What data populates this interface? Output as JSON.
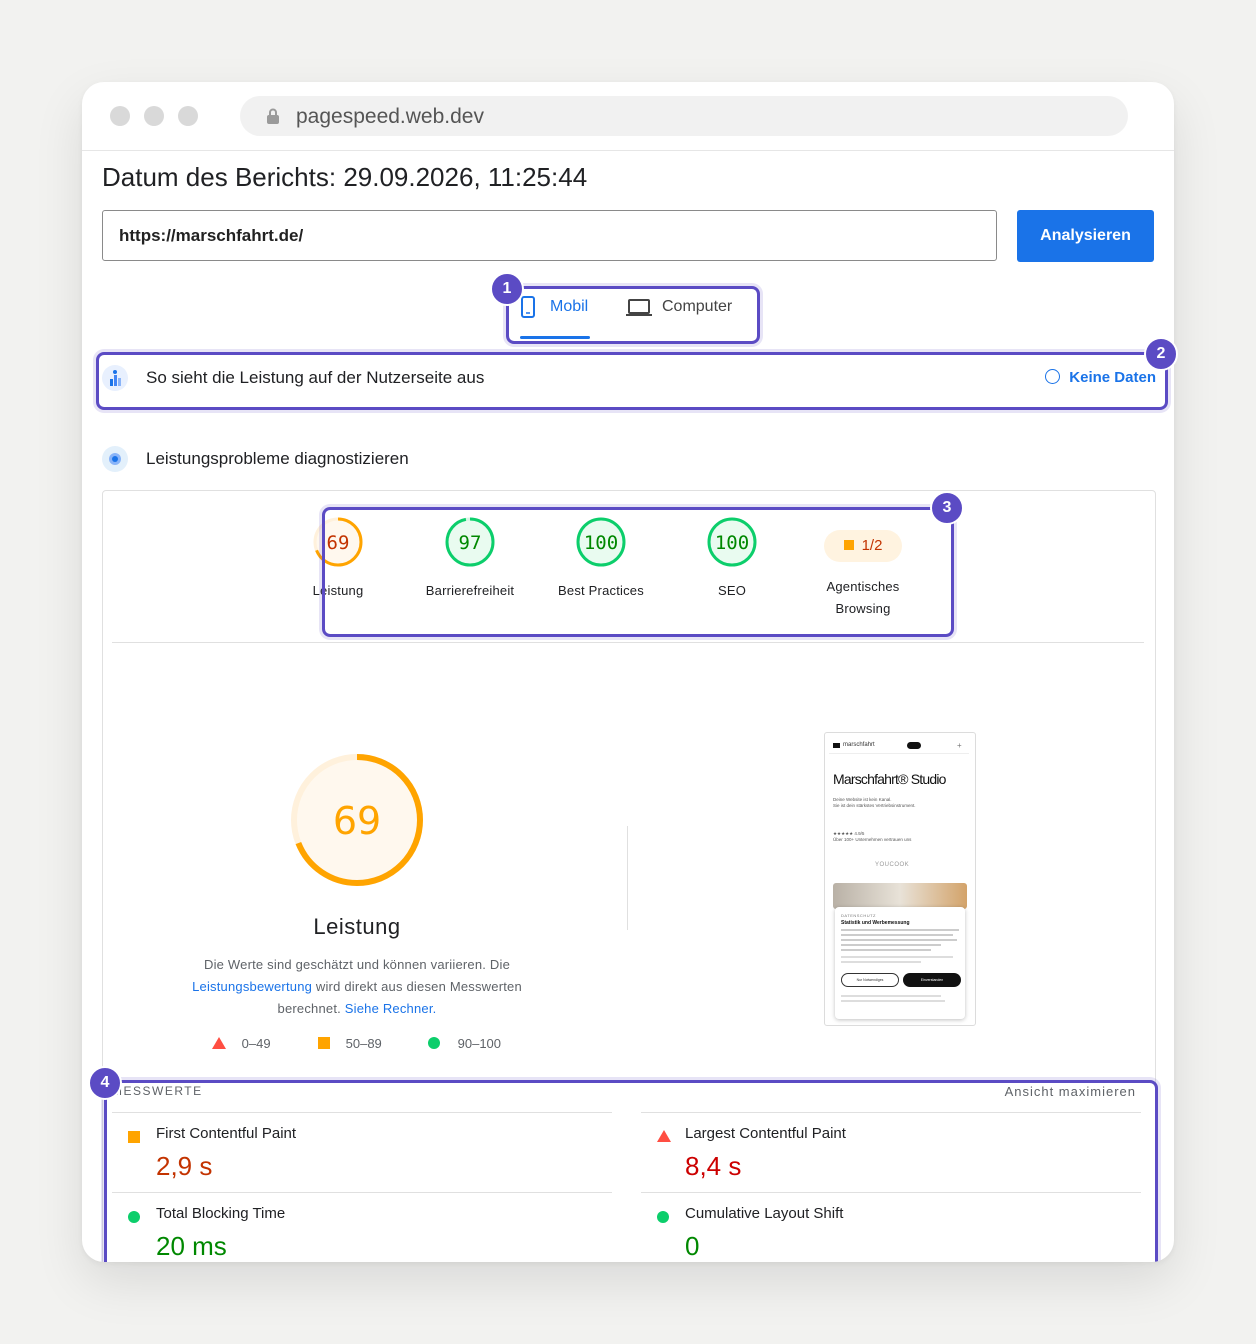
{
  "browser": {
    "url": "pagespeed.web.dev"
  },
  "report": {
    "date_label": "Datum des Berichts: 29.09.2026, 11:25:44",
    "url_value": "https://marschfahrt.de/",
    "analyze_label": "Analysieren"
  },
  "tabs": {
    "mobile": "Mobil",
    "computer": "Computer"
  },
  "field_data": {
    "title": "So sieht die Leistung auf der Nutzerseite aus",
    "status": "Keine Daten"
  },
  "diagnose": {
    "title": "Leistungsprobleme diagnostizieren"
  },
  "scores": [
    {
      "value": "69",
      "label": "Leistung",
      "color": "#ffa400"
    },
    {
      "value": "97",
      "label": "Barrierefreiheit",
      "color": "#0cce6b"
    },
    {
      "value": "100",
      "label": "Best Practices",
      "color": "#0cce6b"
    },
    {
      "value": "100",
      "label": "SEO",
      "color": "#0cce6b"
    }
  ],
  "agentic": {
    "value": "1/2",
    "label_line1": "Agentisches",
    "label_line2": "Browsing"
  },
  "performance": {
    "score": "69",
    "label": "Leistung",
    "desc_part1": "Die Werte sind geschätzt und können variieren. Die",
    "desc_link1": "Leistungsbewertung",
    "desc_part2": "wird direkt aus diesen Messwerten berechnet.",
    "desc_link2": "Siehe Rechner.",
    "legend": [
      "0–49",
      "50–89",
      "90–100"
    ]
  },
  "screenshot": {
    "brand": "marschfahrt",
    "headline": "Marschfahrt® Studio",
    "subline1": "Deine Website ist kein Kanal.",
    "subline2": "Sie ist dein stärkstes Vertriebsinstrument.",
    "rating": "★★★★★ 4.9/5",
    "clients": "Über 100+ Unternehmen vertrauen uns",
    "logo": "YOUCOOK",
    "cookie_kicker": "DATENSCHUTZ",
    "cookie_title": "Statistik und Werbemessung",
    "btn_necessary": "Nur Notwendiges",
    "btn_accept": "Einverstanden"
  },
  "metrics": {
    "heading": "MESSWERTE",
    "expand": "Ansicht maximieren",
    "items": [
      {
        "name": "First Contentful Paint",
        "value": "2,9 s",
        "status": "average"
      },
      {
        "name": "Largest Contentful Paint",
        "value": "8,4 s",
        "status": "fail"
      },
      {
        "name": "Total Blocking Time",
        "value": "20 ms",
        "status": "pass"
      },
      {
        "name": "Cumulative Layout Shift",
        "value": "0",
        "status": "pass"
      }
    ]
  },
  "annotations": [
    "1",
    "2",
    "3",
    "4"
  ],
  "colors": {
    "accent": "#1a73e8",
    "highlight": "#5b4bc4",
    "pass": "#0cce6b",
    "average": "#ffa400",
    "fail": "#ff4e42"
  }
}
